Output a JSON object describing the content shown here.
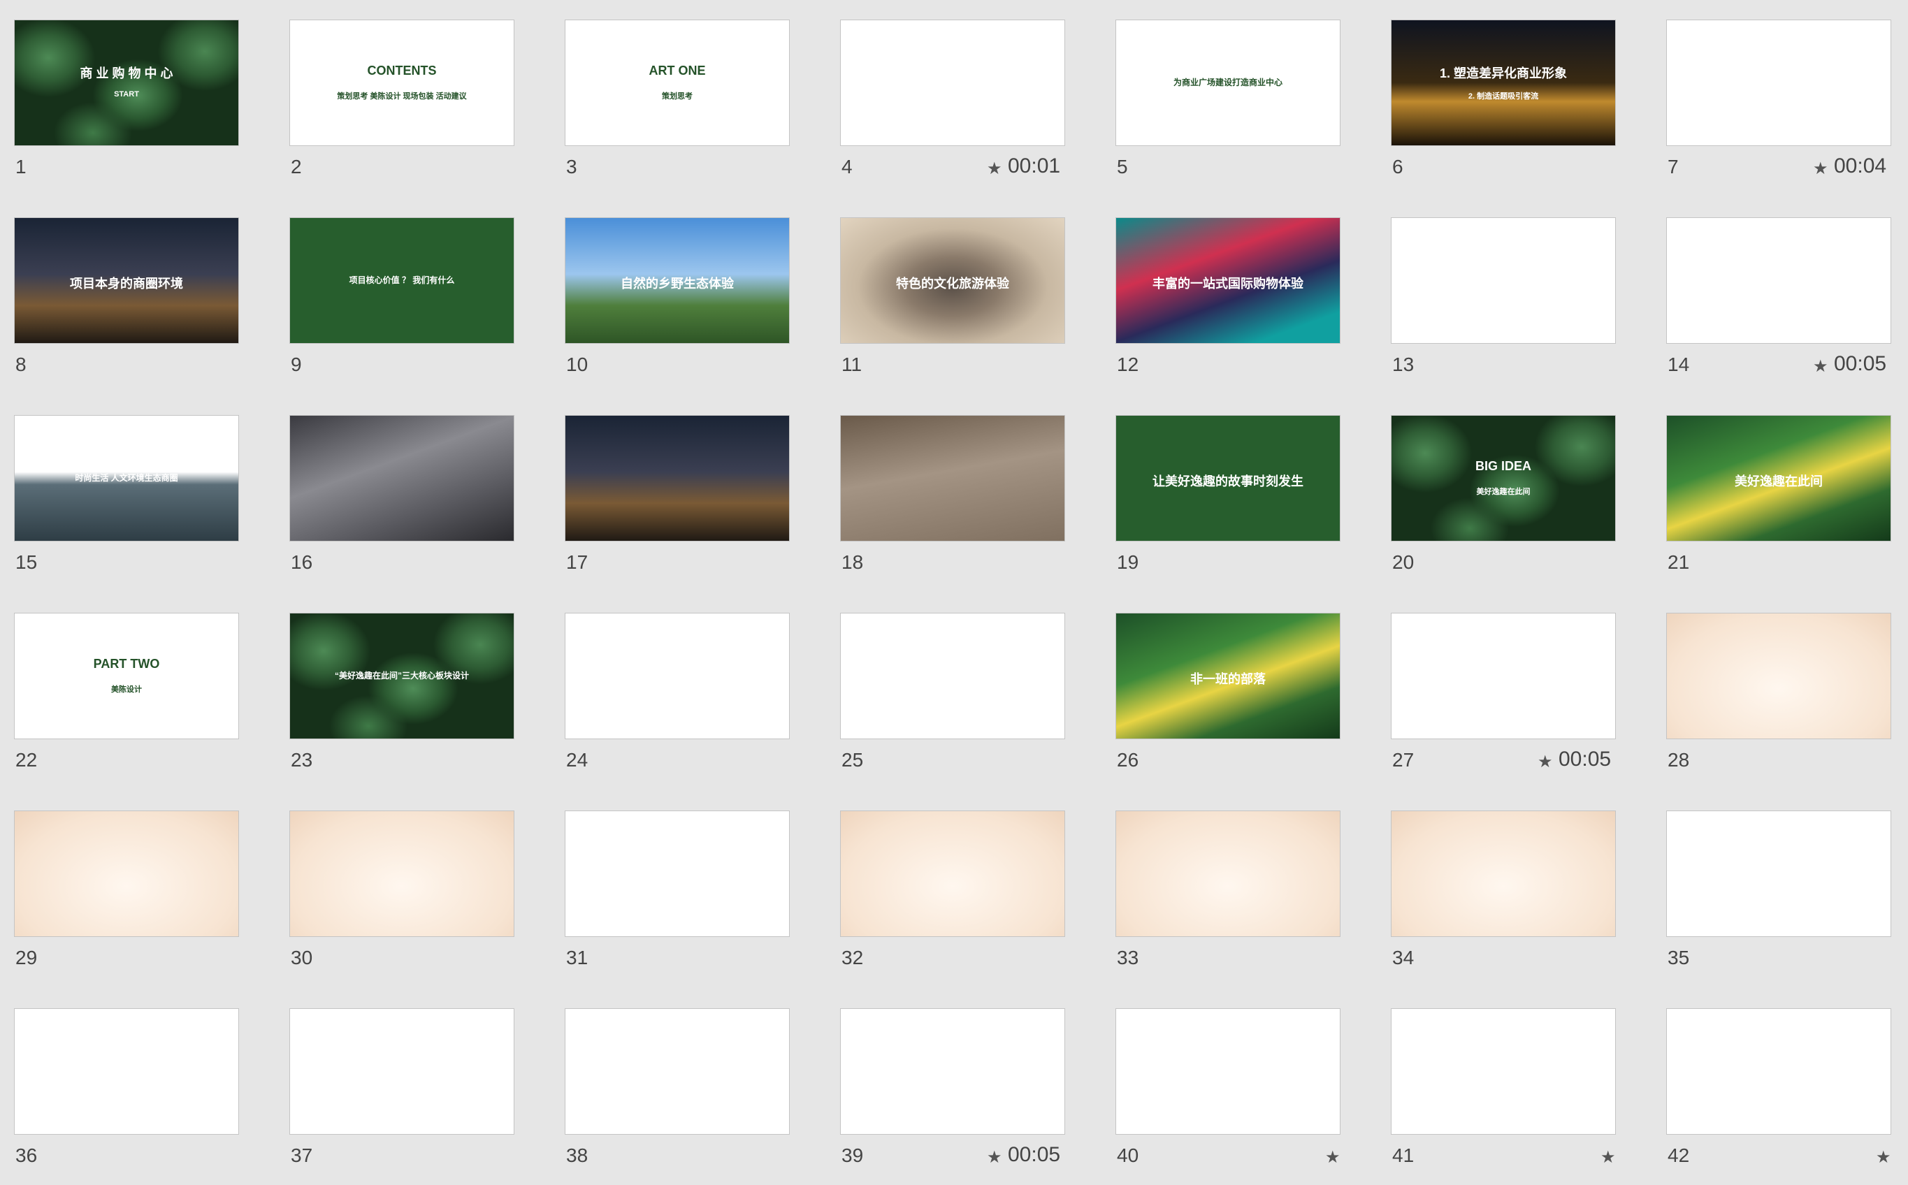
{
  "slides": [
    {
      "num": "1",
      "theme": "leafy",
      "text": "商 业 购 物 中 心",
      "sub": "START"
    },
    {
      "num": "2",
      "theme": "light",
      "text": "CONTENTS",
      "sub": "策划思考  美陈设计  现场包装  活动建议"
    },
    {
      "num": "3",
      "theme": "light",
      "text": "ART ONE",
      "sub": "策划思考"
    },
    {
      "num": "4",
      "theme": "light",
      "text": "",
      "sub": "",
      "timing": "00:01",
      "star": true
    },
    {
      "num": "5",
      "theme": "light",
      "text": "为商业广场建设打造商业中心",
      "sub": ""
    },
    {
      "num": "6",
      "theme": "night",
      "text": "1. 塑造差异化商业形象",
      "sub": "2. 制造话题吸引客流"
    },
    {
      "num": "7",
      "theme": "light",
      "text": "",
      "sub": "",
      "timing": "00:04",
      "star": true
    },
    {
      "num": "8",
      "theme": "city",
      "text": "项目本身的商圈环境",
      "sub": ""
    },
    {
      "num": "9",
      "theme": "green",
      "text": "项目核心价值 ？ 我们有什么",
      "sub": ""
    },
    {
      "num": "10",
      "theme": "sky",
      "text": "自然的乡野生态体验",
      "sub": ""
    },
    {
      "num": "11",
      "theme": "stones",
      "text": "特色的文化旅游体验",
      "sub": ""
    },
    {
      "num": "12",
      "theme": "neon",
      "text": "丰富的一站式国际购物体验",
      "sub": ""
    },
    {
      "num": "13",
      "theme": "light",
      "text": "",
      "sub": ""
    },
    {
      "num": "14",
      "theme": "light",
      "text": "",
      "sub": "",
      "timing": "00:05",
      "star": true
    },
    {
      "num": "15",
      "theme": "mall",
      "text": "时尚生活 人文环境生态商圈",
      "sub": ""
    },
    {
      "num": "16",
      "theme": "crowd",
      "text": "",
      "sub": ""
    },
    {
      "num": "17",
      "theme": "city",
      "text": "",
      "sub": ""
    },
    {
      "num": "18",
      "theme": "sand",
      "text": "",
      "sub": ""
    },
    {
      "num": "19",
      "theme": "green",
      "text": "让美好逸趣的故事时刻发生",
      "sub": ""
    },
    {
      "num": "20",
      "theme": "leafy",
      "text": "BIG IDEA",
      "sub": "美好逸趣在此间"
    },
    {
      "num": "21",
      "theme": "jungle",
      "text": "美好逸趣在此间",
      "sub": ""
    },
    {
      "num": "22",
      "theme": "light",
      "text": "PART TWO",
      "sub": "美陈设计"
    },
    {
      "num": "23",
      "theme": "leafy",
      "text": "“美好逸趣在此间”三大核心板块设计",
      "sub": ""
    },
    {
      "num": "24",
      "theme": "light",
      "text": "",
      "sub": ""
    },
    {
      "num": "25",
      "theme": "light",
      "text": "",
      "sub": ""
    },
    {
      "num": "26",
      "theme": "jungle",
      "text": "非一班的部落",
      "sub": ""
    },
    {
      "num": "27",
      "theme": "light",
      "text": "",
      "sub": "",
      "timing": "00:05",
      "star": true
    },
    {
      "num": "28",
      "theme": "cream",
      "text": "",
      "sub": ""
    },
    {
      "num": "29",
      "theme": "cream",
      "text": "",
      "sub": ""
    },
    {
      "num": "30",
      "theme": "cream",
      "text": "",
      "sub": ""
    },
    {
      "num": "31",
      "theme": "light",
      "text": "",
      "sub": ""
    },
    {
      "num": "32",
      "theme": "cream",
      "text": "",
      "sub": ""
    },
    {
      "num": "33",
      "theme": "cream",
      "text": "",
      "sub": ""
    },
    {
      "num": "34",
      "theme": "cream",
      "text": "",
      "sub": ""
    },
    {
      "num": "35",
      "theme": "light",
      "text": "",
      "sub": ""
    },
    {
      "num": "36",
      "theme": "light",
      "text": "",
      "sub": ""
    },
    {
      "num": "37",
      "theme": "light",
      "text": "",
      "sub": ""
    },
    {
      "num": "38",
      "theme": "light",
      "text": "",
      "sub": ""
    },
    {
      "num": "39",
      "theme": "light",
      "text": "",
      "sub": "",
      "timing": "00:05",
      "star": true
    },
    {
      "num": "40",
      "theme": "light",
      "text": "",
      "sub": "",
      "star": true
    },
    {
      "num": "41",
      "theme": "light",
      "text": "",
      "sub": "",
      "star": true
    },
    {
      "num": "42",
      "theme": "light",
      "text": "",
      "sub": "",
      "star": true
    }
  ],
  "star_glyph": "★",
  "colors": {
    "background": "#e6e6e6",
    "accent_green": "#275e2d"
  }
}
